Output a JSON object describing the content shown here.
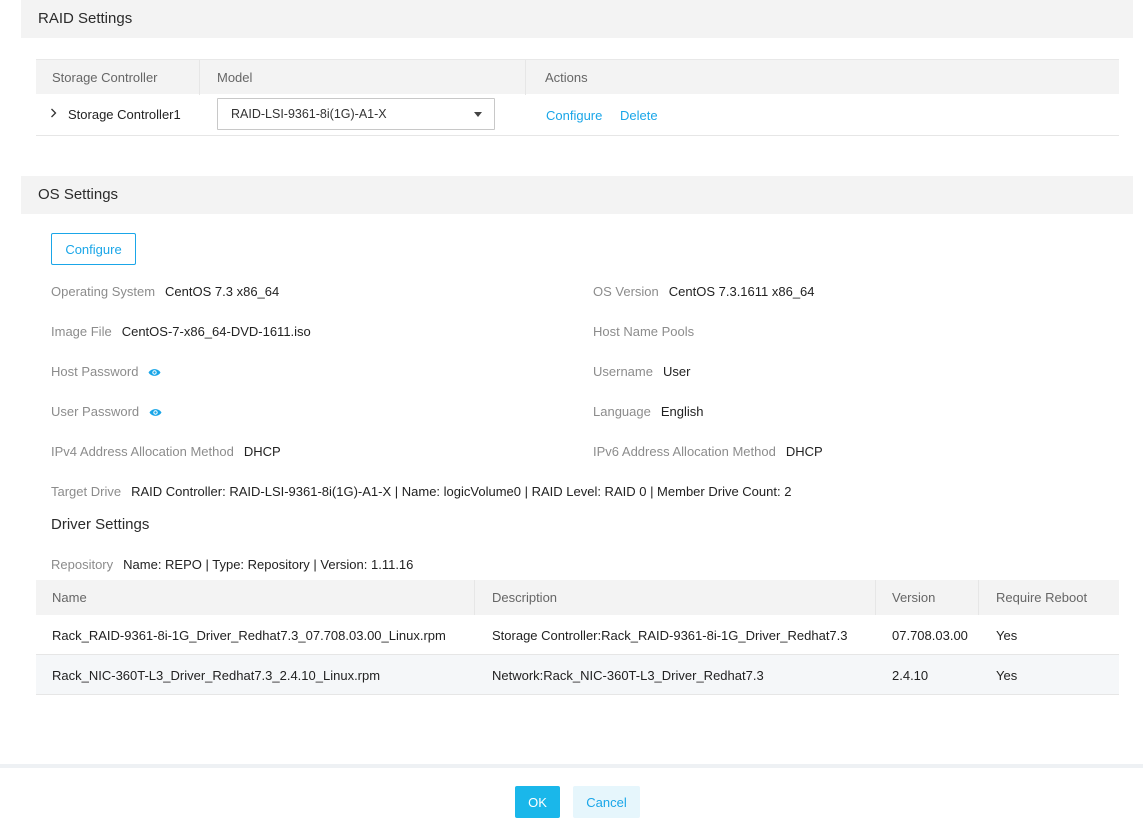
{
  "raid": {
    "title": "RAID Settings",
    "columns": [
      "Storage Controller",
      "Model",
      "Actions"
    ],
    "row": {
      "controller": "Storage Controller1",
      "model": "RAID-LSI-9361-8i(1G)-A1-X",
      "configure": "Configure",
      "delete": "Delete"
    }
  },
  "os": {
    "title": "OS Settings",
    "configure_label": "Configure",
    "fields": {
      "operating_system": {
        "label": "Operating System",
        "value": "CentOS 7.3 x86_64"
      },
      "os_version": {
        "label": "OS Version",
        "value": "CentOS 7.3.1611 x86_64"
      },
      "image_file": {
        "label": "Image File",
        "value": "CentOS-7-x86_64-DVD-1611.iso"
      },
      "host_name_pools": {
        "label": "Host Name Pools",
        "value": ""
      },
      "host_password": {
        "label": "Host Password"
      },
      "username": {
        "label": "Username",
        "value": "User"
      },
      "user_password": {
        "label": "User Password"
      },
      "language": {
        "label": "Language",
        "value": "English"
      },
      "ipv4": {
        "label": "IPv4 Address Allocation Method",
        "value": "DHCP"
      },
      "ipv6": {
        "label": "IPv6 Address Allocation Method",
        "value": "DHCP"
      },
      "target_drive": {
        "label": "Target Drive",
        "value": "RAID Controller: RAID-LSI-9361-8i(1G)-A1-X | Name: logicVolume0 | RAID Level: RAID 0 | Member Drive Count: 2"
      }
    }
  },
  "driver": {
    "title": "Driver Settings",
    "repository": {
      "label": "Repository",
      "value": "Name: REPO | Type: Repository | Version: 1.11.16"
    },
    "columns": [
      "Name",
      "Description",
      "Version",
      "Require Reboot"
    ],
    "rows": [
      {
        "name": "Rack_RAID-9361-8i-1G_Driver_Redhat7.3_07.708.03.00_Linux.rpm",
        "description": "Storage Controller:Rack_RAID-9361-8i-1G_Driver_Redhat7.3",
        "version": "07.708.03.00",
        "reboot": "Yes"
      },
      {
        "name": "Rack_NIC-360T-L3_Driver_Redhat7.3_2.4.10_Linux.rpm",
        "description": "Network:Rack_NIC-360T-L3_Driver_Redhat7.3",
        "version": "2.4.10",
        "reboot": "Yes"
      }
    ]
  },
  "footer": {
    "ok": "OK",
    "cancel": "Cancel"
  },
  "colors": {
    "accent": "#1aa6e8",
    "primary_button": "#1ab7ea",
    "header_bg": "#f3f3f3"
  },
  "icons": {
    "expand": "chevron-right-icon",
    "password_toggle": "eye-icon",
    "dropdown": "caret-down-icon"
  }
}
